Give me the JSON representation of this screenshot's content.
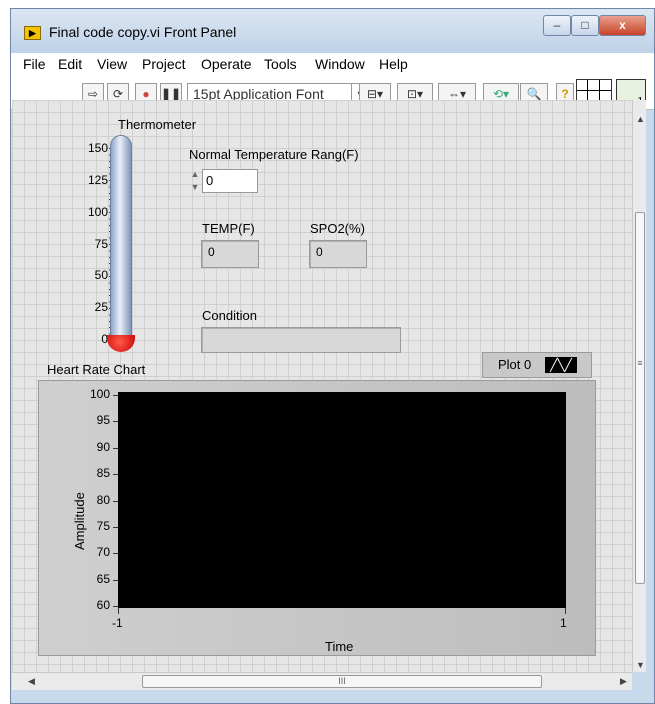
{
  "window": {
    "title": "Final code copy.vi Front Panel",
    "title_icon": "labview-vi-icon",
    "buttons": {
      "minimize": "–",
      "maximize": "□",
      "close": "x"
    }
  },
  "menubar": {
    "items": [
      "File",
      "Edit",
      "View",
      "Project",
      "Operate",
      "Tools",
      "Window",
      "Help"
    ]
  },
  "toolbar": {
    "font_label": "15pt Application Font",
    "vi_icon_badge": "1",
    "icons": [
      "run-arrow-icon",
      "run-continuously-icon",
      "abort-icon",
      "pause-icon",
      "align-icon",
      "distribute-icon",
      "resize-icon",
      "reorder-icon",
      "search-icon",
      "help-icon"
    ]
  },
  "thermometer": {
    "label": "Thermometer",
    "ticks": [
      "150",
      "125",
      "100",
      "75",
      "50",
      "25",
      "0"
    ],
    "value": 0
  },
  "normal_temp": {
    "label": "Normal Temperature Rang(F)",
    "value": "0"
  },
  "temp": {
    "label": "TEMP(F)",
    "value": "0"
  },
  "spo2": {
    "label": "SPO2(%)",
    "value": "0"
  },
  "condition": {
    "label": "Condition",
    "value": ""
  },
  "chart": {
    "label": "Heart Rate Chart",
    "legend_plot": "Plot 0",
    "y_ticks": [
      "100",
      "95",
      "90",
      "85",
      "80",
      "75",
      "70",
      "65",
      "60"
    ],
    "y_label": "Amplitude",
    "x_ticks": [
      "-1",
      "1"
    ],
    "x_label": "Time",
    "background": "#000000"
  },
  "chart_data": {
    "type": "line",
    "title": "Heart Rate Chart",
    "xlabel": "Time",
    "ylabel": "Amplitude",
    "xlim": [
      -1,
      1
    ],
    "ylim": [
      60,
      100
    ],
    "series": [
      {
        "name": "Plot 0",
        "x": [],
        "y": []
      }
    ]
  },
  "scrollbar": {
    "grip": "III",
    "vgrip": "≡"
  }
}
